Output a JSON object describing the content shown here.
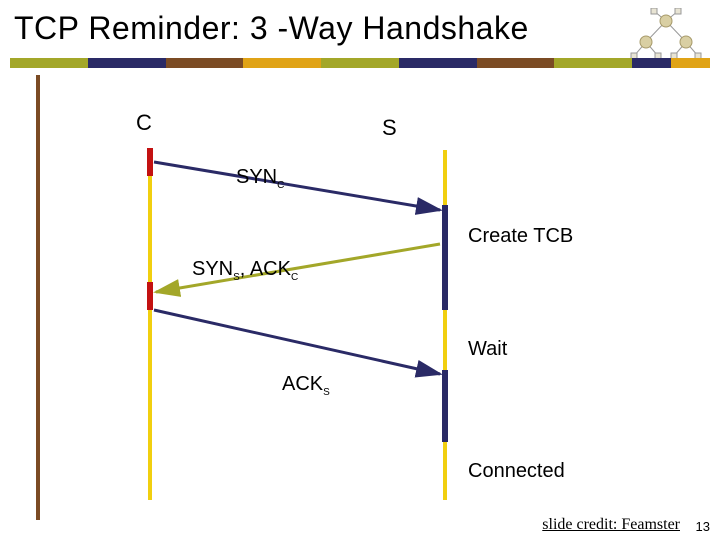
{
  "slide": {
    "title": "TCP Reminder: 3 -Way Handshake",
    "client_label": "C",
    "server_label": "S",
    "msg1_label": "SYN",
    "msg1_sub": "C",
    "msg2_label_a": "SYN",
    "msg2_sub_a": "S",
    "msg2_sep": ", ",
    "msg2_label_b": "ACK",
    "msg2_sub_b": "C",
    "msg3_label": "ACK",
    "msg3_sub": "S",
    "state1": "Create TCB",
    "state2": "Wait",
    "state3": "Connected"
  },
  "footer": {
    "credit": "slide credit: Feamster",
    "page": "13"
  },
  "colors": {
    "olive": "#a3a729",
    "navy": "#2a2a66",
    "brown": "#7b4b24",
    "orange": "#e0a316",
    "yellow": "#f1cf0f",
    "red": "#c31111"
  }
}
